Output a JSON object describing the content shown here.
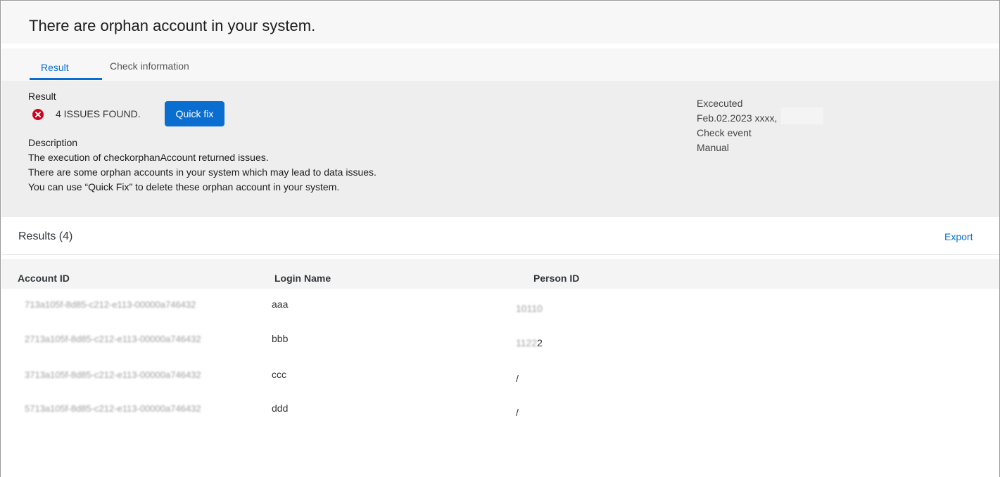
{
  "header": {
    "title": "There are orphan account in your system."
  },
  "tabs": [
    {
      "label": "Result",
      "active": true
    },
    {
      "label": "Check information",
      "active": false
    }
  ],
  "summary": {
    "result_label": "Result",
    "issues_text": "4 ISSUES FOUND.",
    "quick_fix_label": "Quick fix",
    "description_label": "Description",
    "description_lines": [
      "The execution of checkorphanAccount returned issues.",
      "There are some orphan accounts in your system which may lead to data issues.",
      "You can use “Quick Fix” to delete these orphan account in your system."
    ],
    "executed_label": "Excecuted",
    "executed_value": "Feb.02.2023 xxxx,",
    "check_event_label": "Check event",
    "check_event_value": "Manual"
  },
  "results": {
    "title": "Results (4)",
    "export_label": "Export",
    "columns": [
      "Account ID",
      "Login Name",
      "Person ID"
    ],
    "rows": [
      {
        "account_id": "713a105f-8d85-c212-e113-00000a746432",
        "login": "aaa",
        "person_visible": "",
        "person_blurred": "10110"
      },
      {
        "account_id": "2713a105f-8d85-c212-e113-00000a746432",
        "login": "bbb",
        "person_visible": "2",
        "person_blurred": "1122"
      },
      {
        "account_id": "3713a105f-8d85-c212-e113-00000a746432",
        "login": "ccc",
        "person_visible": "/",
        "person_blurred": ""
      },
      {
        "account_id": "5713a105f-8d85-c212-e113-00000a746432",
        "login": "ddd",
        "person_visible": "/",
        "person_blurred": ""
      }
    ]
  },
  "colors": {
    "accent": "#0a6ed1",
    "error": "#d0021b"
  },
  "icons": {
    "status": "error-circle-icon"
  }
}
